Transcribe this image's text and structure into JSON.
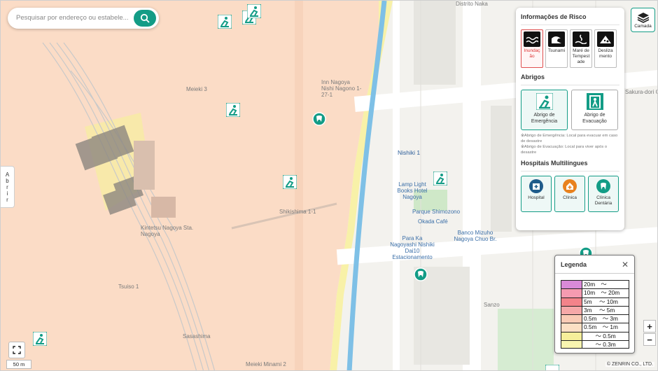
{
  "search": {
    "placeholder": "Pesquisar por endereço ou estabele...",
    "button_icon": "search-icon"
  },
  "side_tab": {
    "chars": [
      "A",
      "b",
      "r",
      "i",
      "r"
    ]
  },
  "layer_button": {
    "label": "Camada",
    "icon": "layers-icon"
  },
  "panel": {
    "risk_title": "Informações de Risco",
    "risk_items": [
      {
        "label": "Inundaç ão",
        "icon": "flood-icon",
        "active": true
      },
      {
        "label": "Tsunami",
        "icon": "tsunami-icon",
        "active": false
      },
      {
        "label": "Maré de Tempest ade",
        "icon": "storm-surge-icon",
        "active": false
      },
      {
        "label": "Desliza mento",
        "icon": "landslide-icon",
        "active": false
      }
    ],
    "shelter_title": "Abrigos",
    "shelter_items": [
      {
        "label": "Abrigo de Emergência",
        "icon": "emergency-shelter-icon",
        "active": true
      },
      {
        "label": "Abrigo de Evacuação",
        "icon": "evacuation-shelter-icon",
        "active": false
      }
    ],
    "notes": [
      "※Abrigo de Emergência: Local para evacuar em caso de desastre",
      "※Abrigo de Evacuação: Local para viver após o desastre"
    ],
    "hospital_title": "Hospitais Multilíngues",
    "hospital_items": [
      {
        "label": "Hospital",
        "icon": "hospital-icon",
        "color": "#1f5b8a"
      },
      {
        "label": "Clínica",
        "icon": "clinic-icon",
        "color": "#e8821e"
      },
      {
        "label": "Clínica Dentária",
        "icon": "dental-icon",
        "color": "#139c86"
      }
    ]
  },
  "legend": {
    "title": "Legenda",
    "close_icon": "close-icon",
    "rows": [
      {
        "text": "20m　～",
        "color": "#d98ad8"
      },
      {
        "text": "10m　～ 20m",
        "color": "#f59bb1"
      },
      {
        "text": "5m　 ～ 10m",
        "color": "#f3838a"
      },
      {
        "text": "3m　 ～ 5m",
        "color": "#f5a8a8"
      },
      {
        "text": "0.5m　～ 3m",
        "color": "#f9cbb5"
      },
      {
        "text": "0.5m　～ 1m",
        "color": "#fbe0c4"
      },
      {
        "text": "　　～ 0.5m",
        "color": "#f6ef9a"
      },
      {
        "text": "　　～ 0.3m",
        "color": "#f8f5b0"
      }
    ]
  },
  "map_labels": {
    "distrito": "Distrito Naka",
    "nishiki1": "Nishiki 1",
    "lamp": "Lamp Light Books Hotel Nagoya",
    "parque": "Parque Shimozono",
    "okada": "Okada Café",
    "banco": "Banco Mizuho Nagoya Chuo Br.",
    "para": "Para Ka Nagoyashi Nishiki Dai10 Estacionamento",
    "meieki3": "Meieki 3",
    "nagono": "Inn Nagoya Nishi Nagono 1-27-1",
    "kintetsu": "Kintetsu Nagoya Sta. Nagoya",
    "tsuiso": "Tsuiso 1",
    "sasashima": "Sasashima",
    "minami": "Meieki Minami 2",
    "sanzo": "Sanzo",
    "sakura": "Sakura-dori Gofuku",
    "chome": "Shikishima 1-1"
  },
  "controls": {
    "zoom_in": "+",
    "zoom_out": "−",
    "scale": "50 m",
    "fullscreen_icon": "fullscreen-icon"
  },
  "copyright": "© ZENRIN CO., LTD."
}
